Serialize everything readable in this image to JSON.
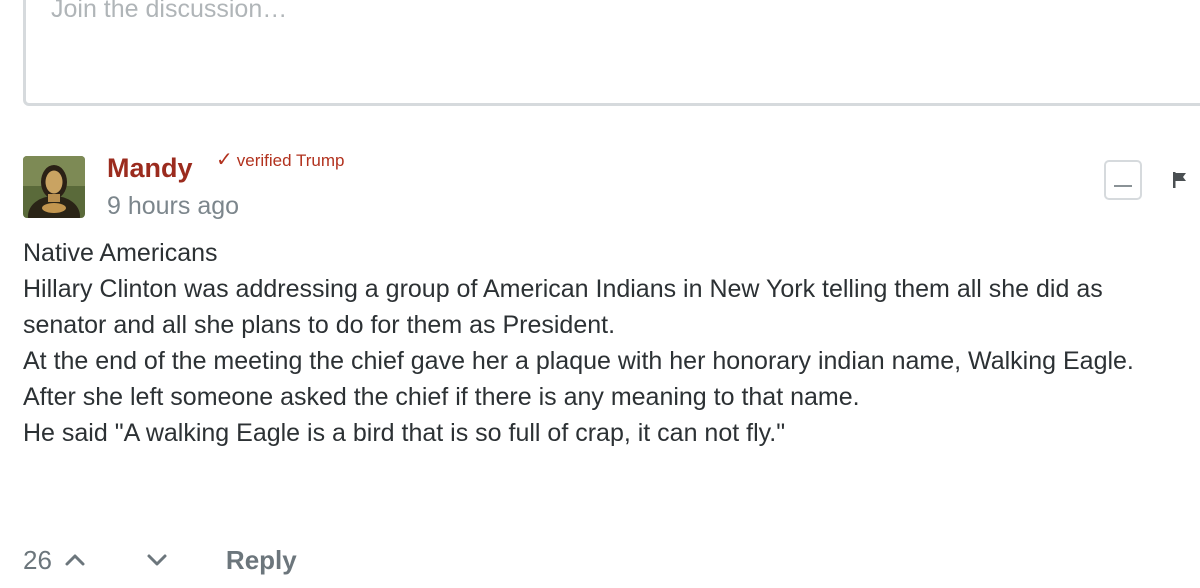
{
  "composer": {
    "placeholder": "Join the discussion…"
  },
  "comment": {
    "author": "Mandy",
    "badge": {
      "check": "✓",
      "label": "verified Trump",
      "color": "#b2321e"
    },
    "author_color": "#9b2b1e",
    "timestamp": "9 hours ago",
    "avatar_icon": "mona-lisa-avatar",
    "collapse_icon": "minus-icon",
    "flag_icon": "flag-icon",
    "body_lines": [
      "Native Americans",
      "Hillary Clinton was addressing a group of American Indians in New York telling them all she did as senator and all she plans to do for them as President.",
      "At the end of the meeting the chief gave her a plaque with her honorary indian name, Walking Eagle.",
      "After she left someone asked the chief if there is any meaning to that name.",
      "He said \"A walking Eagle is a bird that is so full of crap, it can not fly.\""
    ],
    "footer": {
      "vote_count": "26",
      "upvote_icon": "chevron-up-icon",
      "downvote_icon": "chevron-down-icon",
      "reply_label": "Reply"
    }
  }
}
